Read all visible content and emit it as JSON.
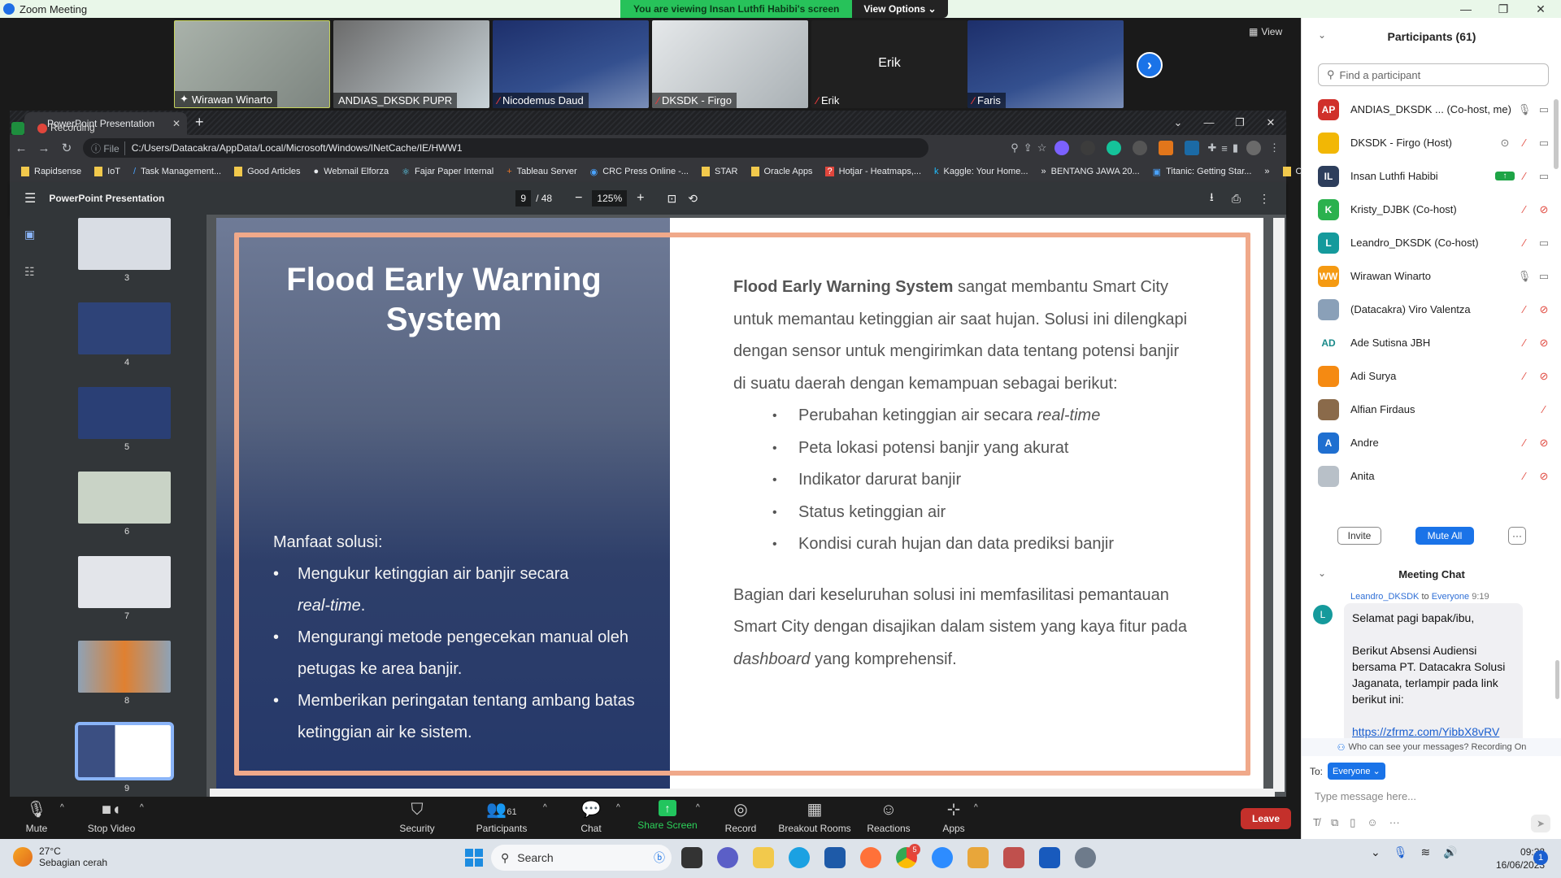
{
  "zoom_window": {
    "title": "Zoom Meeting",
    "viewing_banner": "You are viewing Insan Luthfi Habibi's screen",
    "view_options": "View Options",
    "window_controls": [
      "minimize-icon",
      "restore-icon",
      "close-icon"
    ]
  },
  "video_strip": {
    "tiles": [
      {
        "name": "Wirawan Winarto",
        "muted": false,
        "type": "video"
      },
      {
        "name": "ANDIAS_DKSDK PUPR",
        "muted": false,
        "type": "video"
      },
      {
        "name": "Nicodemus Daud",
        "muted": true,
        "type": "slide-bg"
      },
      {
        "name": "DKSDK - Firgo",
        "muted": true,
        "type": "video"
      },
      {
        "name": "Erik",
        "muted": true,
        "type": "name-only"
      },
      {
        "name": "Faris",
        "muted": true,
        "type": "slide-bg"
      }
    ],
    "next_icon": "chevron-right-icon",
    "view_label": "View"
  },
  "chrome": {
    "tab_title": "PowerPoint Presentation",
    "recording_label": "Recording",
    "address_scheme": "File",
    "address": "C:/Users/Datacakra/AppData/Local/Microsoft/Windows/INetCache/IE/HWW1",
    "bookmarks": [
      "Rapidsense",
      "IoT",
      "Task Management...",
      "Good Articles",
      "Webmail Elforza",
      "Fajar Paper Internal",
      "Tableau Server",
      "CRC Press Online -...",
      "STAR",
      "Oracle Apps",
      "Hotjar - Heatmaps,...",
      "Kaggle: Your Home...",
      "BENTANG JAWA 20...",
      "Titanic: Getting Star..."
    ],
    "bookmarks_overflow": "»",
    "other_bookmarks": "Other bookmarks"
  },
  "pdf_viewer": {
    "title": "PowerPoint Presentation",
    "current_page": "9",
    "total_pages": "/ 48",
    "zoom": "125%",
    "thumbnails": [
      "3",
      "4",
      "5",
      "6",
      "7",
      "8",
      "9"
    ],
    "selected_page": "9"
  },
  "slide": {
    "title": "Flood Early Warning System",
    "benefits_heading": "Manfaat solusi:",
    "benefits": [
      {
        "text": "Mengukur ketinggian air banjir secara ",
        "italic": "real-time",
        "after": "."
      },
      {
        "text": "Mengurangi metode pengecekan manual oleh petugas ke area banjir.",
        "italic": "",
        "after": ""
      },
      {
        "text": "Memberikan peringatan tentang ambang batas ketinggian air ke sistem.",
        "italic": "",
        "after": ""
      }
    ],
    "intro_bold": "Flood Early Warning System",
    "intro_rest": " sangat membantu Smart City untuk memantau ketinggian air saat hujan. Solusi ini dilengkapi dengan sensor untuk mengirimkan data tentang potensi banjir di suatu daerah dengan kemampuan sebagai berikut:",
    "features": [
      {
        "text": "Perubahan ketinggian air secara ",
        "italic": "real-time"
      },
      {
        "text": "Peta lokasi potensi banjir yang akurat",
        "italic": ""
      },
      {
        "text": "Indikator darurat banjir",
        "italic": ""
      },
      {
        "text": "Status ketinggian air",
        "italic": ""
      },
      {
        "text": "Kondisi curah hujan dan data prediksi banjir",
        "italic": ""
      }
    ],
    "closing_a": "Bagian dari keseluruhan solusi ini memfasilitasi pemantauan Smart City dengan disajikan dalam sistem yang kaya fitur pada ",
    "closing_italic": "dashboard",
    "closing_b": " yang komprehensif."
  },
  "zoom_controls": {
    "mute": "Mute",
    "stop_video": "Stop Video",
    "security": "Security",
    "participants": "Participants",
    "participants_count": "61",
    "chat": "Chat",
    "share_screen": "Share Screen",
    "record": "Record",
    "breakout_rooms": "Breakout Rooms",
    "reactions": "Reactions",
    "apps": "Apps",
    "leave": "Leave"
  },
  "participants_panel": {
    "title": "Participants (61)",
    "search_placeholder": "Find a participant",
    "participants": [
      {
        "initials": "AP",
        "name": "ANDIAS_DKSDK ...  (Co-host, me)",
        "color": "#d0302b",
        "mic": "on",
        "video": "on",
        "extra": ""
      },
      {
        "initials": "",
        "name": "DKSDK - Firgo (Host)",
        "color": "#f2b705",
        "mic": "muted",
        "video": "on",
        "extra": "recording"
      },
      {
        "initials": "IL",
        "name": "Insan Luthfi Habibi",
        "color": "#2d3e5c",
        "mic": "muted",
        "video": "on",
        "extra": "sharing"
      },
      {
        "initials": "K",
        "name": "Kristy_DJBK (Co-host)",
        "color": "#2bb14e",
        "mic": "muted",
        "video": "off",
        "extra": ""
      },
      {
        "initials": "L",
        "name": "Leandro_DKSDK (Co-host)",
        "color": "#159a9c",
        "mic": "muted",
        "video": "on",
        "extra": ""
      },
      {
        "initials": "WW",
        "name": "Wirawan Winarto",
        "color": "#f59a12",
        "mic": "speaking",
        "video": "on",
        "extra": ""
      },
      {
        "initials": "",
        "name": "(Datacakra) Viro Valentza",
        "color": "#8aa0b8",
        "mic": "muted",
        "video": "off",
        "extra": ""
      },
      {
        "initials": "AD",
        "name": "Ade Sutisna JBH",
        "color": "#ffffff",
        "mic": "muted",
        "video": "off",
        "extra": ""
      },
      {
        "initials": "",
        "name": "Adi Surya",
        "color": "#f58a12",
        "mic": "muted",
        "video": "off",
        "extra": ""
      },
      {
        "initials": "",
        "name": "Alfian Firdaus",
        "color": "#8a6a4a",
        "mic": "muted",
        "video": "none",
        "extra": ""
      },
      {
        "initials": "A",
        "name": "Andre",
        "color": "#1f6fd0",
        "mic": "muted",
        "video": "off",
        "extra": ""
      },
      {
        "initials": "",
        "name": "Anita",
        "color": "#b8c0c8",
        "mic": "muted",
        "video": "off",
        "extra": ""
      }
    ],
    "invite": "Invite",
    "mute_all": "Mute All",
    "more": "···"
  },
  "chat_panel": {
    "title": "Meeting Chat",
    "sender": "Leandro_DKSDK",
    "to_text": " to ",
    "recipient": "Everyone",
    "time": "9:19",
    "avatar_initial": "L",
    "message": "Selamat pagi bapak/ibu,\n\nBerikut Absensi Audiensi bersama PT. Datacakra Solusi Jaganata, terlampir pada link berikut ini:\n\n",
    "link": "https://zfrmz.com/YibbX8vRV",
    "visibility_note": "Who can see your messages? Recording On",
    "to_label": "To:",
    "to_value": "Everyone",
    "input_placeholder": "Type message here..."
  },
  "taskbar": {
    "temperature": "27°C",
    "weather": "Sebagian cerah",
    "search_placeholder": "Search",
    "time": "09:32",
    "date": "16/06/2023",
    "notifications": "1",
    "chrome_badge": "5"
  }
}
